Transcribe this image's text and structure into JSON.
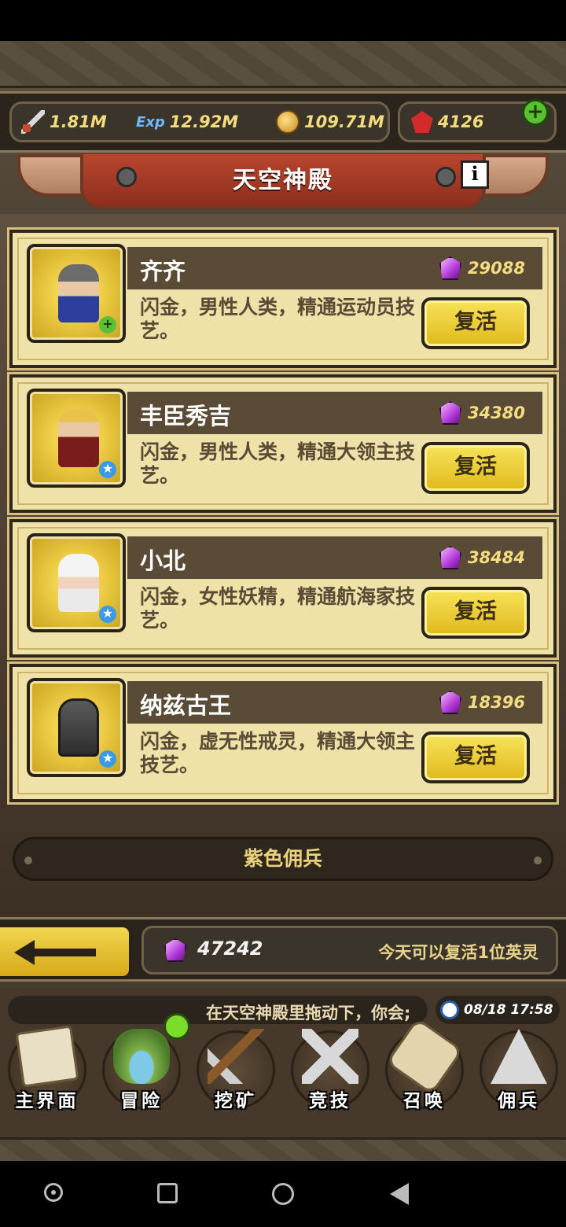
{
  "resources": {
    "attack": "1.81M",
    "exp_label": "Exp",
    "exp": "12.92M",
    "gold": "109.71M",
    "rubies": "4126"
  },
  "title": "天空神殿",
  "info_label": "i",
  "heroes": [
    {
      "name": "齐齐",
      "cost": "29088",
      "desc": "闪金，男性人类，精通运动员技艺。",
      "button": "复活",
      "badge": "+"
    },
    {
      "name": "丰臣秀吉",
      "cost": "34380",
      "desc": "闪金，男性人类，精通大领主技艺。",
      "button": "复活",
      "badge": "★"
    },
    {
      "name": "小北",
      "cost": "38484",
      "desc": "闪金，女性妖精，精通航海家技艺。",
      "button": "复活",
      "badge": "★"
    },
    {
      "name": "纳兹古王",
      "cost": "18396",
      "desc": "闪金，虚无性戒灵，精通大领主技艺。",
      "button": "复活",
      "badge": "★"
    }
  ],
  "section_tab": "紫色佣兵",
  "gem_balance": "47242",
  "revive_note": "今天可以复活1位英灵",
  "ticker": "在天空神殿里拖动下，你会;",
  "clock": "08/18 17:58",
  "nav": [
    {
      "label": "主界面",
      "icon": "map-scroll-icon"
    },
    {
      "label": "冒险",
      "icon": "island-icon"
    },
    {
      "label": "挖矿",
      "icon": "pickaxe-icon"
    },
    {
      "label": "竞技",
      "icon": "crossed-swords-icon"
    },
    {
      "label": "召唤",
      "icon": "scroll-icon"
    },
    {
      "label": "佣兵",
      "icon": "tent-icon"
    }
  ],
  "colors": {
    "gold_text": "#f2dc7c",
    "card_bg": "#efe2a8",
    "banner_red": "#b8462e",
    "button_yellow": "#f7e35a"
  }
}
